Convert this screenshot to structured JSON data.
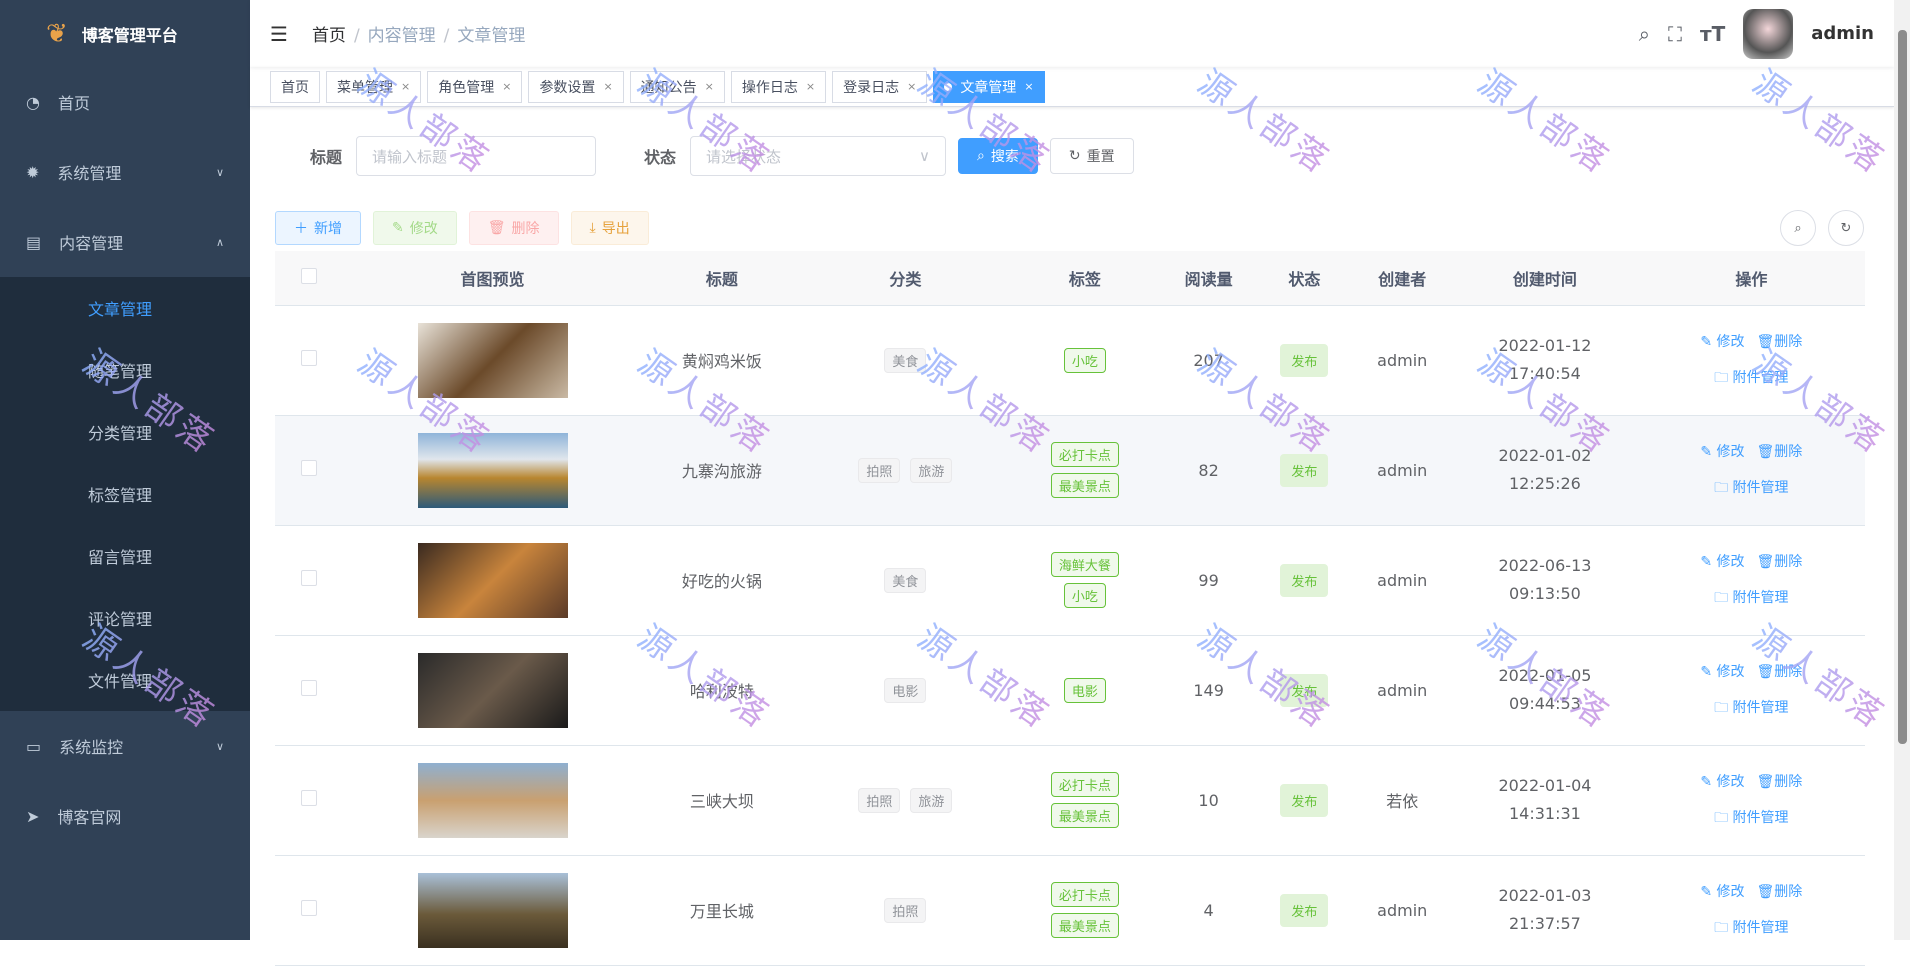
{
  "app": {
    "title": "博客管理平台",
    "user": "admin",
    "watermark": "源人部落"
  },
  "sidebar": {
    "items": [
      {
        "label": "首页"
      },
      {
        "label": "系统管理"
      },
      {
        "label": "内容管理"
      },
      {
        "label": "系统监控"
      },
      {
        "label": "博客官网"
      }
    ],
    "sub": [
      "文章管理",
      "随笔管理",
      "分类管理",
      "标签管理",
      "留言管理",
      "评论管理",
      "文件管理"
    ]
  },
  "breadcrumb": [
    "首页",
    "内容管理",
    "文章管理"
  ],
  "tags": [
    "首页",
    "菜单管理",
    "角色管理",
    "参数设置",
    "通知公告",
    "操作日志",
    "登录日志",
    "文章管理"
  ],
  "search": {
    "title_label": "标题",
    "title_placeholder": "请输入标题",
    "status_label": "状态",
    "status_placeholder": "请选择状态",
    "search": "搜索",
    "reset": "重置"
  },
  "toolbar": {
    "add": "新增",
    "edit": "修改",
    "delete": "删除",
    "export": "导出"
  },
  "table": {
    "headers": [
      "首图预览",
      "标题",
      "分类",
      "标签",
      "阅读量",
      "状态",
      "创建者",
      "创建时间",
      "操作"
    ],
    "ops": {
      "edit": "修改",
      "delete": "删除",
      "attach": "附件管理"
    },
    "rows": [
      {
        "title": "黄焖鸡米饭",
        "cats": [
          "美食"
        ],
        "tags": [
          "小吃"
        ],
        "reads": "207",
        "status": "发布",
        "creator": "admin",
        "date": "2022-01-12",
        "time": "17:40:54"
      },
      {
        "title": "九寨沟旅游",
        "cats": [
          "拍照",
          "旅游"
        ],
        "tags": [
          "必打卡点",
          "最美景点"
        ],
        "reads": "82",
        "status": "发布",
        "creator": "admin",
        "date": "2022-01-02",
        "time": "12:25:26"
      },
      {
        "title": "好吃的火锅",
        "cats": [
          "美食"
        ],
        "tags": [
          "海鲜大餐",
          "小吃"
        ],
        "reads": "99",
        "status": "发布",
        "creator": "admin",
        "date": "2022-06-13",
        "time": "09:13:50"
      },
      {
        "title": "哈利波特",
        "cats": [
          "电影"
        ],
        "tags": [
          "电影"
        ],
        "reads": "149",
        "status": "发布",
        "creator": "admin",
        "date": "2022-01-05",
        "time": "09:44:53"
      },
      {
        "title": "三峡大坝",
        "cats": [
          "拍照",
          "旅游"
        ],
        "tags": [
          "必打卡点",
          "最美景点"
        ],
        "reads": "10",
        "status": "发布",
        "creator": "若依",
        "date": "2022-01-04",
        "time": "14:31:31"
      },
      {
        "title": "万里长城",
        "cats": [
          "拍照"
        ],
        "tags": [
          "必打卡点",
          "最美景点"
        ],
        "reads": "4",
        "status": "发布",
        "creator": "admin",
        "date": "2022-01-03",
        "time": "21:37:57"
      }
    ]
  }
}
